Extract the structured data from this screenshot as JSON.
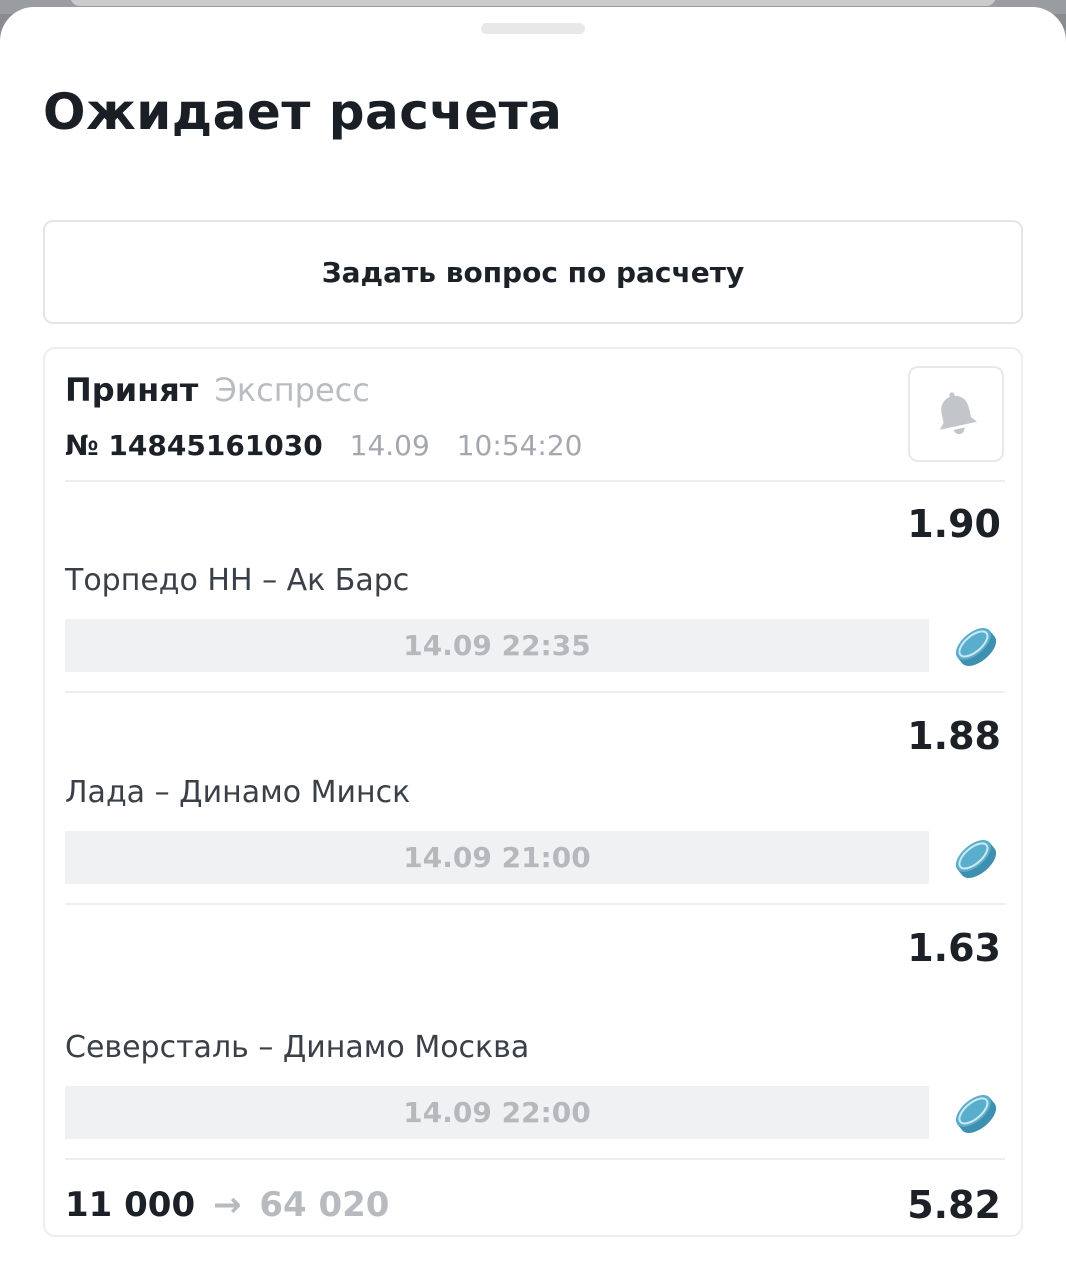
{
  "sheet": {
    "title": "Ожидает расчета",
    "ask_button_label": "Задать вопрос по расчету"
  },
  "bet": {
    "status": "Принят",
    "type": "Экспресс",
    "number": "№ 14845161030",
    "date": "14.09",
    "time": "10:54:20",
    "events": [
      {
        "odds": "1.90",
        "match": "Торпедо НН – Ак Барс",
        "start": "14.09 22:35",
        "sport_icon": "hockey-puck-icon"
      },
      {
        "odds": "1.88",
        "match": "Лада – Динамо Минск",
        "start": "14.09 21:00",
        "sport_icon": "hockey-puck-icon"
      },
      {
        "odds": "1.63",
        "match": "Северсталь – Динамо Москва",
        "start": "14.09 22:00",
        "sport_icon": "hockey-puck-icon"
      }
    ],
    "summary": {
      "stake": "11 000",
      "arrow": "→",
      "potential_win": "64 020",
      "total_odds": "5.82"
    }
  },
  "colors": {
    "puck": "#4a9fbf",
    "text_primary": "#1c2128",
    "text_muted": "#b9bcc1"
  }
}
